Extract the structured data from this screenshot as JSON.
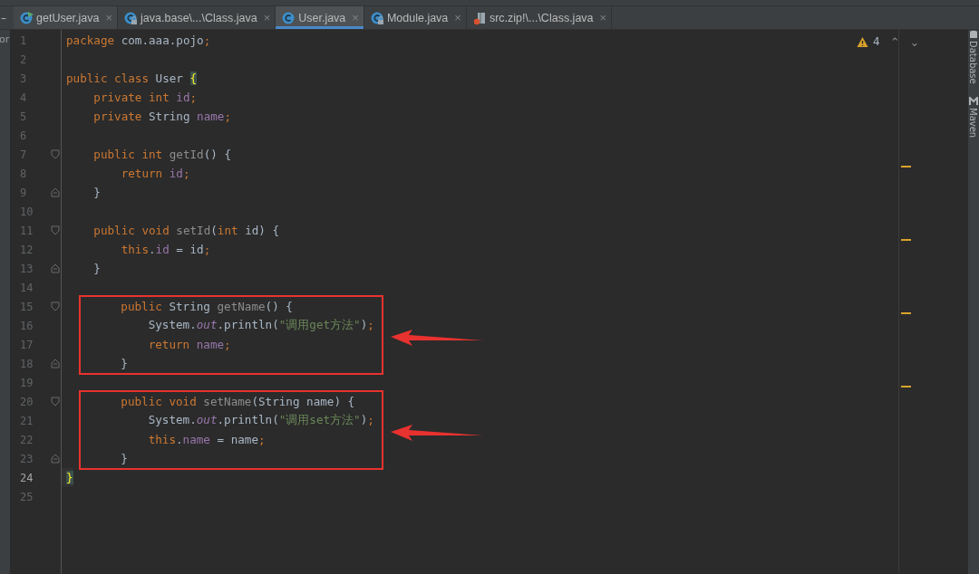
{
  "toolbar": {
    "collapse": "–"
  },
  "tabs": [
    {
      "label": "getUser.java",
      "kind": "class-run",
      "selected": false,
      "close": "×"
    },
    {
      "label": "java.base\\...\\Class.java",
      "kind": "class-lock",
      "selected": false,
      "close": "×"
    },
    {
      "label": "User.java",
      "kind": "class",
      "selected": true,
      "close": "×"
    },
    {
      "label": "Module.java",
      "kind": "class-lock",
      "selected": false,
      "close": "×"
    },
    {
      "label": "src.zip!\\...\\Class.java",
      "kind": "archive",
      "selected": false,
      "close": "×"
    }
  ],
  "project_panel": {
    "text": "or"
  },
  "inspections": {
    "count": "4",
    "up": "⌃",
    "down": "⌄"
  },
  "editor": {
    "blocks": [
      {
        "highlighted": false,
        "lines": [
          {
            "number": "1",
            "current": false,
            "kind": "code",
            "tokens": [
              {
                "text": "package ",
                "kind": "keyword"
              },
              {
                "text": "com.aaa.pojo",
                "kind": "plain"
              },
              {
                "text": ";",
                "kind": "keyword"
              }
            ]
          },
          {
            "number": "2",
            "current": false,
            "kind": "code"
          },
          {
            "number": "3",
            "current": false,
            "kind": "code",
            "tokens": [
              {
                "text": "public class ",
                "kind": "keyword"
              },
              {
                "text": "User ",
                "kind": "plain"
              },
              {
                "text": "{",
                "kind": "brace-match"
              }
            ]
          },
          {
            "number": "4",
            "current": false,
            "kind": "code",
            "tokens": [
              {
                "text": "    private int ",
                "kind": "keyword"
              },
              {
                "text": "id",
                "kind": "field"
              },
              {
                "text": ";",
                "kind": "keyword"
              }
            ]
          },
          {
            "number": "5",
            "current": false,
            "kind": "code",
            "tokens": [
              {
                "text": "    private ",
                "kind": "keyword"
              },
              {
                "text": "String ",
                "kind": "plain"
              },
              {
                "text": "name",
                "kind": "field"
              },
              {
                "text": ";",
                "kind": "keyword"
              }
            ]
          },
          {
            "number": "6",
            "current": false,
            "kind": "code"
          },
          {
            "number": "7",
            "current": false,
            "kind": "fold-start",
            "tokens": [
              {
                "text": "    public int ",
                "kind": "keyword"
              },
              {
                "text": "getId",
                "kind": "unused"
              },
              {
                "text": "() {",
                "kind": "plain"
              }
            ]
          },
          {
            "number": "8",
            "current": false,
            "kind": "code",
            "tokens": [
              {
                "text": "        return ",
                "kind": "keyword"
              },
              {
                "text": "id",
                "kind": "field"
              },
              {
                "text": ";",
                "kind": "keyword"
              }
            ]
          },
          {
            "number": "9",
            "current": false,
            "kind": "fold-end",
            "tokens": [
              {
                "text": "    }",
                "kind": "plain"
              }
            ]
          },
          {
            "number": "10",
            "current": false,
            "kind": "code"
          },
          {
            "number": "11",
            "current": false,
            "kind": "fold-start",
            "tokens": [
              {
                "text": "    public void ",
                "kind": "keyword"
              },
              {
                "text": "setId",
                "kind": "unused"
              },
              {
                "text": "(",
                "kind": "plain"
              },
              {
                "text": "int ",
                "kind": "keyword"
              },
              {
                "text": "id) {",
                "kind": "plain"
              }
            ]
          },
          {
            "number": "12",
            "current": false,
            "kind": "code",
            "tokens": [
              {
                "text": "        this",
                "kind": "keyword"
              },
              {
                "text": ".",
                "kind": "plain"
              },
              {
                "text": "id",
                "kind": "field"
              },
              {
                "text": " = id",
                "kind": "plain"
              },
              {
                "text": ";",
                "kind": "keyword"
              }
            ]
          },
          {
            "number": "13",
            "current": false,
            "kind": "fold-end",
            "tokens": [
              {
                "text": "    }",
                "kind": "plain"
              }
            ]
          },
          {
            "number": "14",
            "current": false,
            "kind": "code"
          }
        ]
      },
      {
        "highlighted": true,
        "lines": [
          {
            "number": "15",
            "current": false,
            "kind": "fold-start",
            "tokens": [
              {
                "text": "    public ",
                "kind": "keyword"
              },
              {
                "text": "String ",
                "kind": "plain"
              },
              {
                "text": "getName",
                "kind": "unused"
              },
              {
                "text": "() {",
                "kind": "plain"
              }
            ]
          },
          {
            "number": "16",
            "current": false,
            "kind": "code",
            "tokens": [
              {
                "text": "        System.",
                "kind": "plain"
              },
              {
                "text": "out",
                "kind": "static"
              },
              {
                "text": ".println(",
                "kind": "plain"
              },
              {
                "text": "\"调用get方法\"",
                "kind": "string"
              },
              {
                "text": ")",
                "kind": "plain"
              },
              {
                "text": ";",
                "kind": "keyword"
              }
            ]
          },
          {
            "number": "17",
            "current": false,
            "kind": "code",
            "tokens": [
              {
                "text": "        return ",
                "kind": "keyword"
              },
              {
                "text": "name",
                "kind": "field"
              },
              {
                "text": ";",
                "kind": "keyword"
              }
            ]
          },
          {
            "number": "18",
            "current": false,
            "kind": "fold-end",
            "tokens": [
              {
                "text": "    }",
                "kind": "plain"
              }
            ]
          }
        ]
      },
      {
        "highlighted": false,
        "lines": [
          {
            "number": "19",
            "current": false,
            "kind": "code"
          }
        ]
      },
      {
        "highlighted": true,
        "lines": [
          {
            "number": "20",
            "current": false,
            "kind": "fold-start",
            "tokens": [
              {
                "text": "    public void ",
                "kind": "keyword"
              },
              {
                "text": "setName",
                "kind": "unused"
              },
              {
                "text": "(String name) {",
                "kind": "plain"
              }
            ]
          },
          {
            "number": "21",
            "current": false,
            "kind": "code",
            "tokens": [
              {
                "text": "        System.",
                "kind": "plain"
              },
              {
                "text": "out",
                "kind": "static"
              },
              {
                "text": ".println(",
                "kind": "plain"
              },
              {
                "text": "\"调用set方法\"",
                "kind": "string"
              },
              {
                "text": ")",
                "kind": "plain"
              },
              {
                "text": ";",
                "kind": "keyword"
              }
            ]
          },
          {
            "number": "22",
            "current": false,
            "kind": "code",
            "tokens": [
              {
                "text": "        this",
                "kind": "keyword"
              },
              {
                "text": ".",
                "kind": "plain"
              },
              {
                "text": "name",
                "kind": "field"
              },
              {
                "text": " = name",
                "kind": "plain"
              },
              {
                "text": ";",
                "kind": "keyword"
              }
            ]
          },
          {
            "number": "23",
            "current": false,
            "kind": "fold-end",
            "tokens": [
              {
                "text": "    }",
                "kind": "plain"
              }
            ]
          }
        ]
      },
      {
        "highlighted": false,
        "lines": [
          {
            "number": "24",
            "current": true,
            "kind": "code",
            "tokens": [
              {
                "text": "}",
                "kind": "brace-match"
              }
            ]
          },
          {
            "number": "25",
            "current": false,
            "kind": "code"
          }
        ]
      }
    ]
  },
  "warning_marks": [
    {
      "kind": "warning"
    },
    {
      "kind": "warning"
    },
    {
      "kind": "warning"
    },
    {
      "kind": "warning"
    }
  ],
  "tool_windows": [
    {
      "label": "Database",
      "kind": "database"
    },
    {
      "label": "Maven",
      "kind": "maven"
    }
  ]
}
